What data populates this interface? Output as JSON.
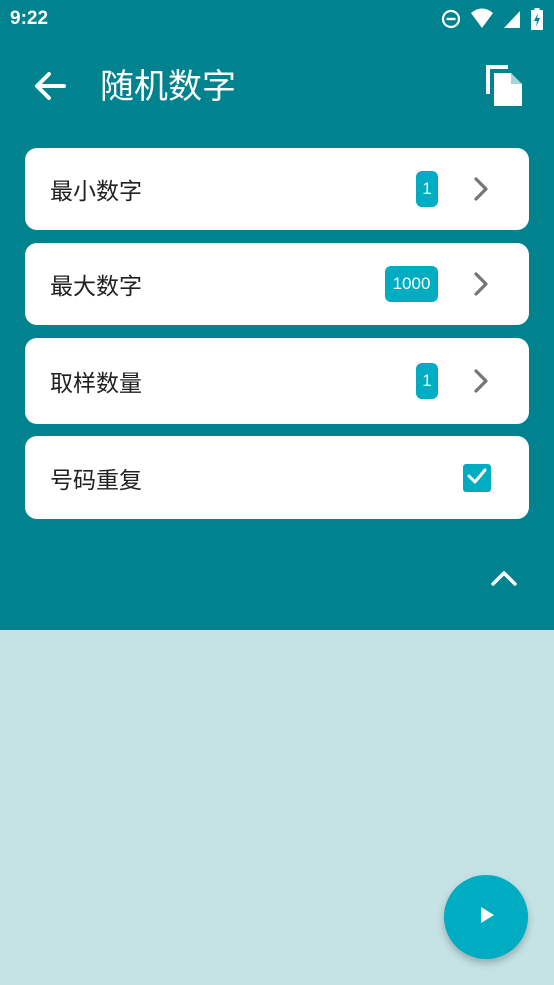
{
  "status_bar": {
    "time": "9:22",
    "icons": [
      "do-not-disturb-icon",
      "wifi-icon",
      "signal-icon",
      "battery-charging-icon"
    ]
  },
  "app_bar": {
    "title": "随机数字",
    "back_icon": "arrow-back-icon",
    "copy_icon": "copy-icon"
  },
  "settings": {
    "min": {
      "label": "最小数字",
      "value": "1"
    },
    "max": {
      "label": "最大数字",
      "value": "1000"
    },
    "count": {
      "label": "取样数量",
      "value": "1"
    },
    "repeat": {
      "label": "号码重复",
      "checked": true
    }
  },
  "actions": {
    "collapse_icon": "chevron-up-icon",
    "fab_icon": "play-icon"
  },
  "colors": {
    "primary": "#00838f",
    "accent": "#00acc1",
    "background": "#c5e3e5",
    "card": "#ffffff"
  }
}
